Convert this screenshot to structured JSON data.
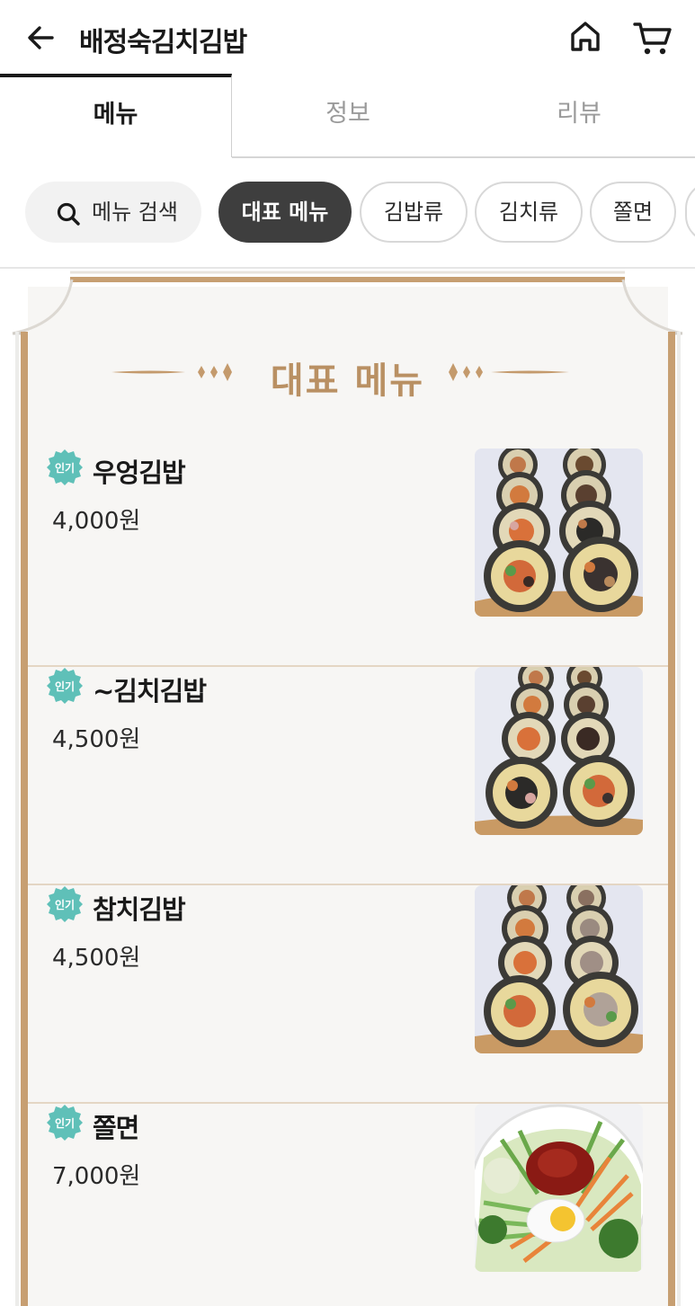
{
  "header": {
    "title": "배정숙김치김밥",
    "icons": {
      "back": "arrow-left-icon",
      "home": "home-icon",
      "cart": "cart-icon"
    }
  },
  "tabs": [
    {
      "label": "메뉴",
      "active": true
    },
    {
      "label": "정보",
      "active": false
    },
    {
      "label": "리뷰",
      "active": false
    }
  ],
  "chips": {
    "search_label": "메뉴 검색",
    "items": [
      {
        "label": "대표 메뉴",
        "active": true
      },
      {
        "label": "김밥류",
        "active": false
      },
      {
        "label": "김치류",
        "active": false
      },
      {
        "label": "쫄면",
        "active": false
      }
    ]
  },
  "section": {
    "title": "대표 메뉴"
  },
  "menu": [
    {
      "badge": "인기",
      "name": "우엉김밥",
      "price": "4,000원",
      "image": "kimbap-photo"
    },
    {
      "badge": "인기",
      "name": "~김치김밥",
      "price": "4,500원",
      "image": "kimbap-photo"
    },
    {
      "badge": "인기",
      "name": "참치김밥",
      "price": "4,500원",
      "image": "kimbap-photo"
    },
    {
      "badge": "인기",
      "name": "쫄면",
      "price": "7,000원",
      "image": "jjolmyeon-photo"
    }
  ],
  "colors": {
    "accent_gold": "#b99063",
    "badge_teal": "#5fc0b8",
    "active_chip": "#3e3e3e"
  }
}
